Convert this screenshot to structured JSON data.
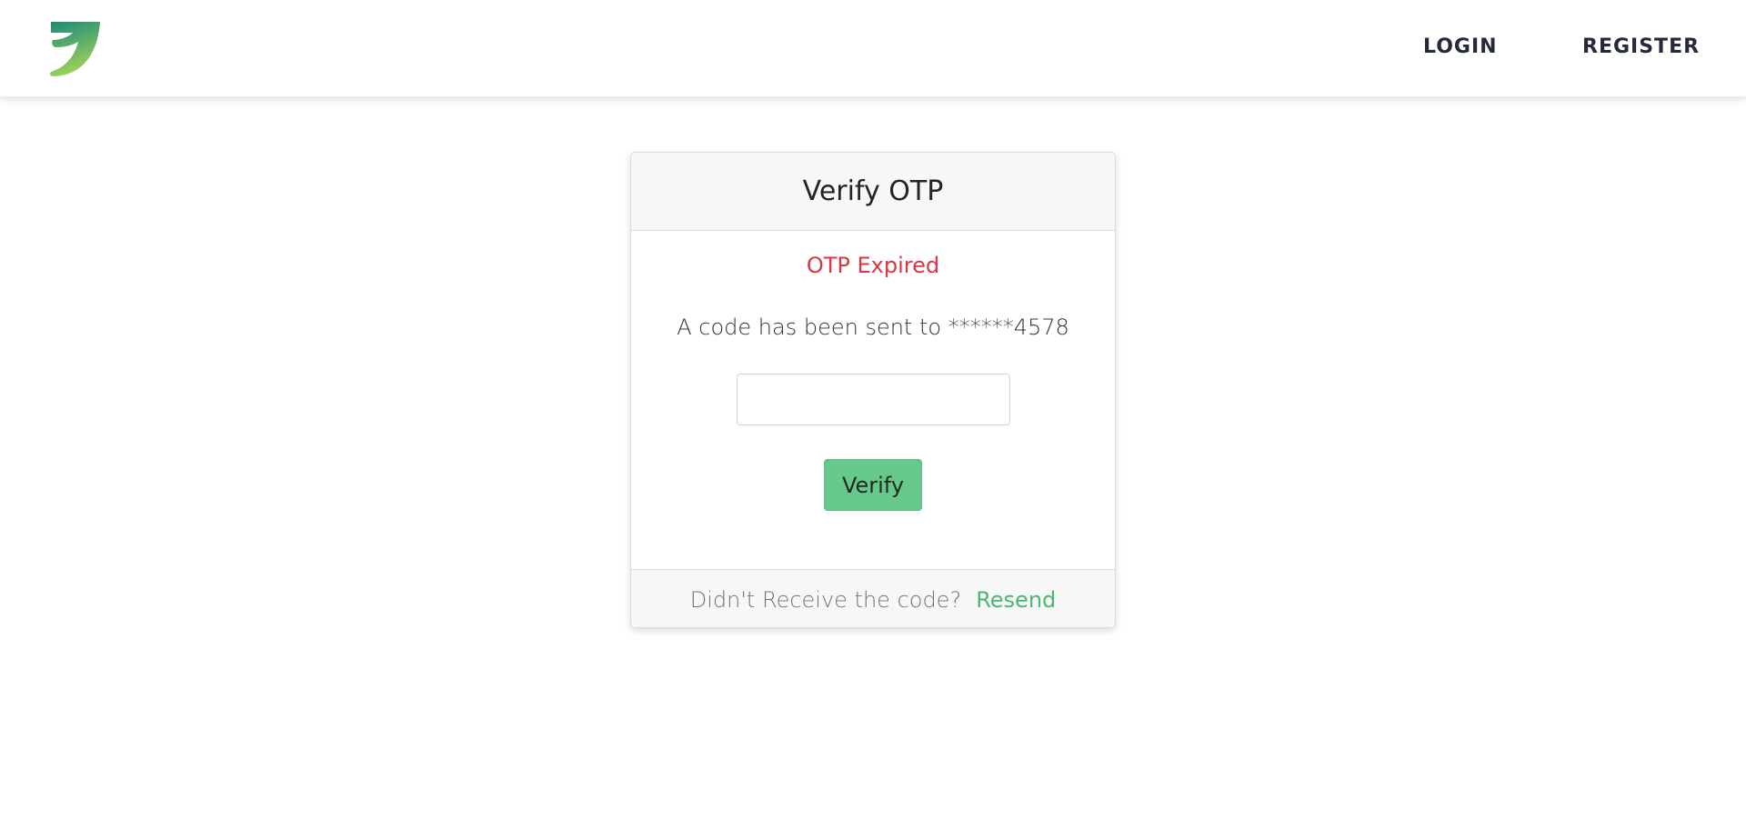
{
  "navbar": {
    "logo_icon": "leaf-logo-icon",
    "login_label": "LOGIN",
    "register_label": "REGISTER"
  },
  "otp_card": {
    "title": "Verify OTP",
    "status_message": "OTP Expired",
    "sent_message": "A code has been sent to ******4578",
    "otp_input": {
      "value": "",
      "placeholder": ""
    },
    "verify_label": "Verify",
    "footer_text": "Didn't Receive the code?",
    "resend_label": "Resend"
  },
  "colors": {
    "accent_green": "#66c98b",
    "link_green": "#4cb86e",
    "error_red": "#dc3545",
    "logo_gradient_top": "#1d8a78",
    "logo_gradient_bottom": "#9fd25a"
  }
}
